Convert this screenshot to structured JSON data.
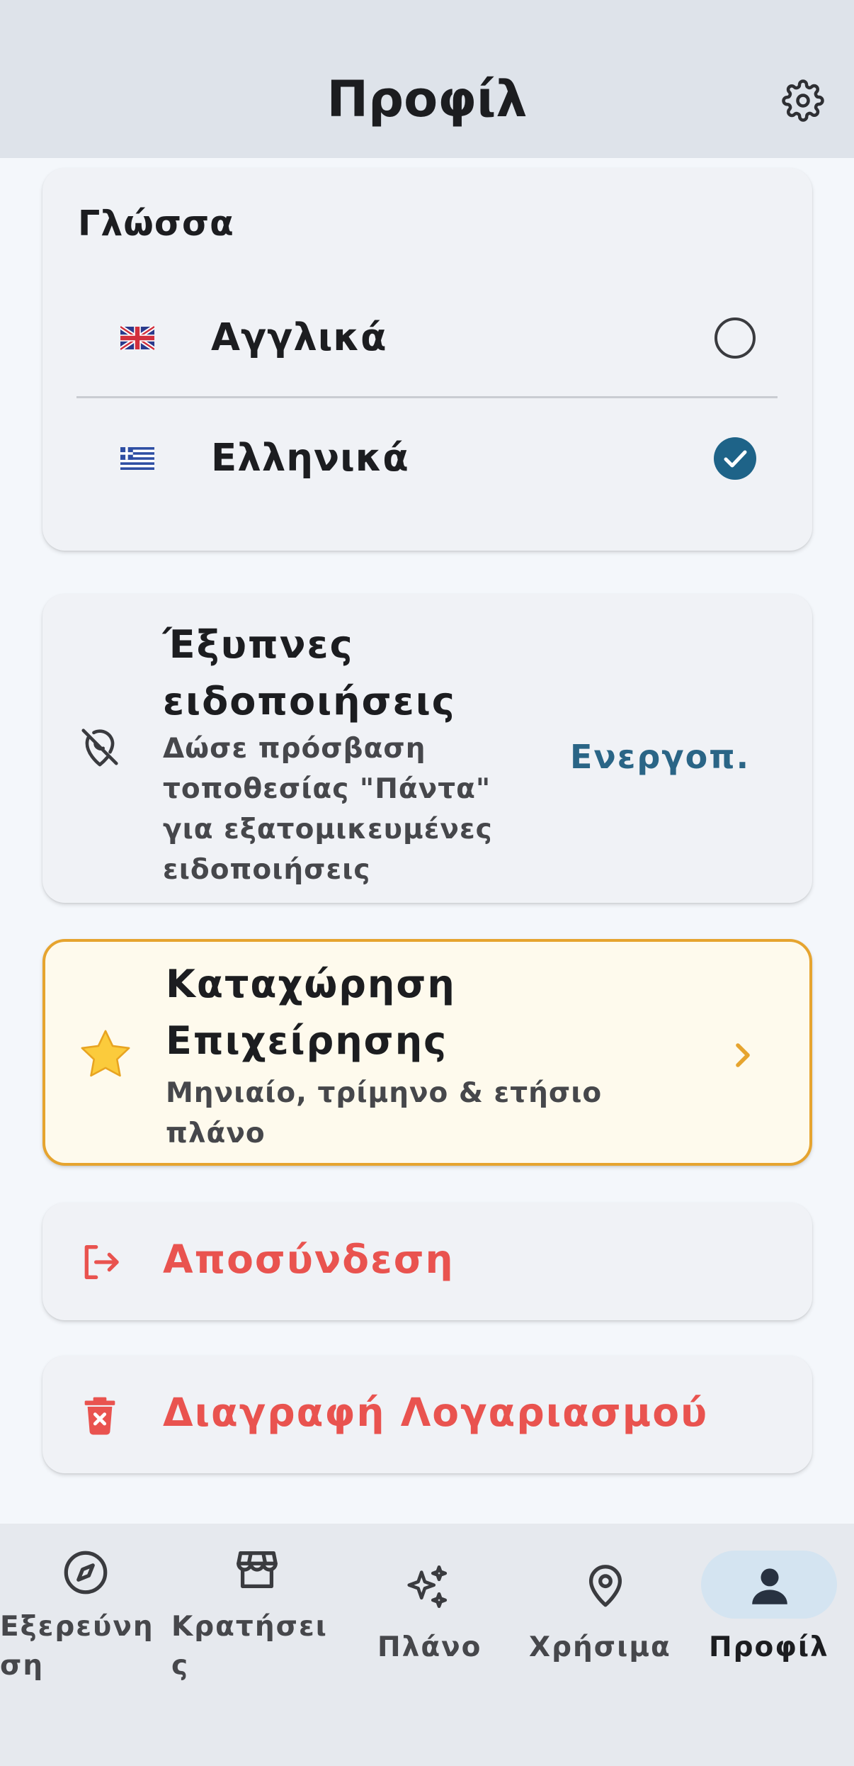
{
  "header": {
    "title": "Προφίλ",
    "settings_icon": "gear-icon"
  },
  "language": {
    "title": "Γλώσσα",
    "options": [
      {
        "label": "Αγγλικά",
        "flag": "uk-flag-icon",
        "selected": false
      },
      {
        "label": "Ελληνικά",
        "flag": "greece-flag-icon",
        "selected": true
      }
    ]
  },
  "smart_notifications": {
    "title_line1": "Έξυπνες",
    "title_line2": "ειδοποιήσεις",
    "desc_line1": "Δώσε πρόσβαση",
    "desc_line2": "τοποθεσίας \"Πάντα\"",
    "desc_line3": "για εξατομικευμένες",
    "desc_line4": "ειδοποιήσεις",
    "action_label": "Ενεργοπ.",
    "icon": "location-off-icon"
  },
  "business_listing": {
    "title_line1": "Καταχώρηση",
    "title_line2": "Επιχείρησης",
    "desc_line1": "Μηνιαίο, τρίμηνο & ετήσιο",
    "desc_line2": "πλάνο",
    "icon": "star-icon"
  },
  "logout": {
    "label": "Αποσύνδεση",
    "icon": "logout-icon"
  },
  "delete_account": {
    "label": "Διαγραφή Λογαριασμού",
    "icon": "trash-icon"
  },
  "bottom_nav": {
    "items": [
      {
        "label_line1": "Εξερεύνη",
        "label_line2": "ση",
        "icon": "compass-icon"
      },
      {
        "label_line1": "Κρατήσει",
        "label_line2": "ς",
        "icon": "store-icon"
      },
      {
        "label": "Πλάνο",
        "icon": "sparkles-icon"
      },
      {
        "label": "Χρήσιμα",
        "icon": "location-pin-icon"
      },
      {
        "label": "Προφίλ",
        "icon": "person-icon",
        "active": true
      }
    ]
  },
  "colors": {
    "accent": "#1e6388",
    "danger": "#e9534f",
    "highlight_border": "#e6a42f",
    "active_pill": "#d4e4f1"
  }
}
